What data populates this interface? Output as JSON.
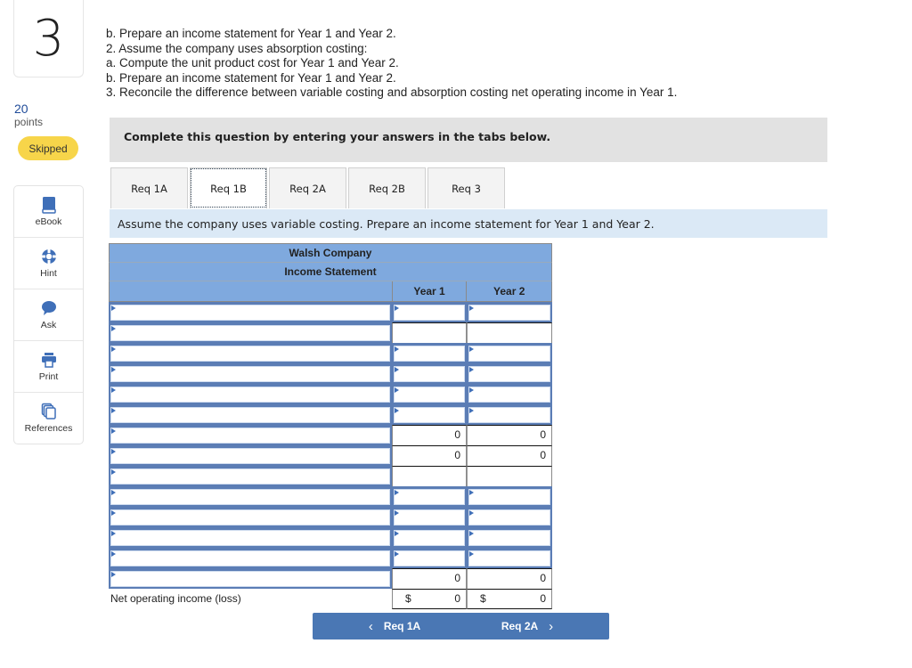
{
  "question": {
    "number": "3",
    "points_value": "20",
    "points_label": "points",
    "status": "Skipped"
  },
  "tools": [
    {
      "label": "eBook",
      "icon": "book-icon"
    },
    {
      "label": "Hint",
      "icon": "lifebuoy-icon"
    },
    {
      "label": "Ask",
      "icon": "speech-bubble-icon"
    },
    {
      "label": "Print",
      "icon": "printer-icon"
    },
    {
      "label": "References",
      "icon": "documents-icon"
    }
  ],
  "instructions": [
    "b. Prepare an income statement for Year 1 and Year 2.",
    "2. Assume the company uses absorption costing:",
    "a. Compute the unit product cost for Year 1 and Year 2.",
    "b. Prepare an income statement for Year 1 and Year 2.",
    "3. Reconcile the difference between variable costing and absorption costing net operating income in Year 1."
  ],
  "banner": "Complete this question by entering your answers in the tabs below.",
  "tabs": [
    {
      "label": "Req 1A",
      "active": false
    },
    {
      "label": "Req 1B",
      "active": true
    },
    {
      "label": "Req 2A",
      "active": false
    },
    {
      "label": "Req 2B",
      "active": false
    },
    {
      "label": "Req 3",
      "active": false
    }
  ],
  "prompt": "Assume the company uses variable costing. Prepare an income statement for Year 1 and Year 2.",
  "statement": {
    "company": "Walsh Company",
    "title": "Income Statement",
    "col_year1": "Year 1",
    "col_year2": "Year 2",
    "rows": [
      {
        "type": "input",
        "label": "",
        "year1": "",
        "year2": "",
        "year1_kind": "input",
        "year2_kind": "input"
      },
      {
        "type": "input",
        "label": "",
        "year1": "",
        "year2": "",
        "year1_kind": "calc",
        "year2_kind": "calc"
      },
      {
        "type": "input",
        "label": "",
        "year1": "",
        "year2": "",
        "year1_kind": "input",
        "year2_kind": "input"
      },
      {
        "type": "input",
        "label": "",
        "year1": "",
        "year2": "",
        "year1_kind": "input",
        "year2_kind": "input"
      },
      {
        "type": "input",
        "label": "",
        "year1": "",
        "year2": "",
        "year1_kind": "input",
        "year2_kind": "input"
      },
      {
        "type": "input",
        "label": "",
        "year1": "",
        "year2": "",
        "year1_kind": "input",
        "year2_kind": "input"
      },
      {
        "type": "input",
        "label": "",
        "year1": "0",
        "year2": "0",
        "year1_kind": "calc",
        "year2_kind": "calc"
      },
      {
        "type": "input",
        "label": "",
        "year1": "0",
        "year2": "0",
        "year1_kind": "calc",
        "year2_kind": "calc"
      },
      {
        "type": "input",
        "label": "",
        "year1": "",
        "year2": "",
        "year1_kind": "calc",
        "year2_kind": "calc"
      },
      {
        "type": "input",
        "label": "",
        "year1": "",
        "year2": "",
        "year1_kind": "input",
        "year2_kind": "input"
      },
      {
        "type": "input",
        "label": "",
        "year1": "",
        "year2": "",
        "year1_kind": "input",
        "year2_kind": "input"
      },
      {
        "type": "input",
        "label": "",
        "year1": "",
        "year2": "",
        "year1_kind": "input",
        "year2_kind": "input"
      },
      {
        "type": "input",
        "label": "",
        "year1": "",
        "year2": "",
        "year1_kind": "input",
        "year2_kind": "input"
      },
      {
        "type": "input",
        "label": "",
        "year1": "0",
        "year2": "0",
        "year1_kind": "calc",
        "year2_kind": "calc"
      }
    ],
    "total": {
      "label": "Net operating income (loss)",
      "currency": "$",
      "year1": "0",
      "year2": "0"
    }
  },
  "nav": {
    "prev_label": "Req 1A",
    "next_label": "Req 2A",
    "prev_chevron": "‹",
    "next_chevron": "›"
  },
  "colors": {
    "accent": "#4a77b4",
    "header_blue": "#7fa9de",
    "prompt_bg": "#dbe9f6",
    "skipped_badge": "#f7d54a",
    "points_color": "#1f4b99"
  }
}
